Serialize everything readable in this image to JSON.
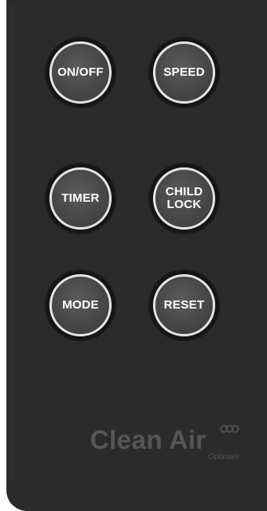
{
  "buttons": {
    "on_off": "ON/OFF",
    "speed": "SPEED",
    "timer": "TIMER",
    "child_lock_line1": "CHILD",
    "child_lock_line2": "LOCK",
    "mode": "MODE",
    "reset": "RESET"
  },
  "brand": {
    "name_part1": "Clean",
    "name_part2": "Air",
    "sub": "Optima",
    "registered": "®"
  },
  "colors": {
    "remote_body": "#2b2b2b",
    "button_fill": "#474747",
    "button_ring": "#e6e6e6",
    "logo": "#565656"
  },
  "icons": {
    "logo_mark": "three-circles-icon"
  }
}
